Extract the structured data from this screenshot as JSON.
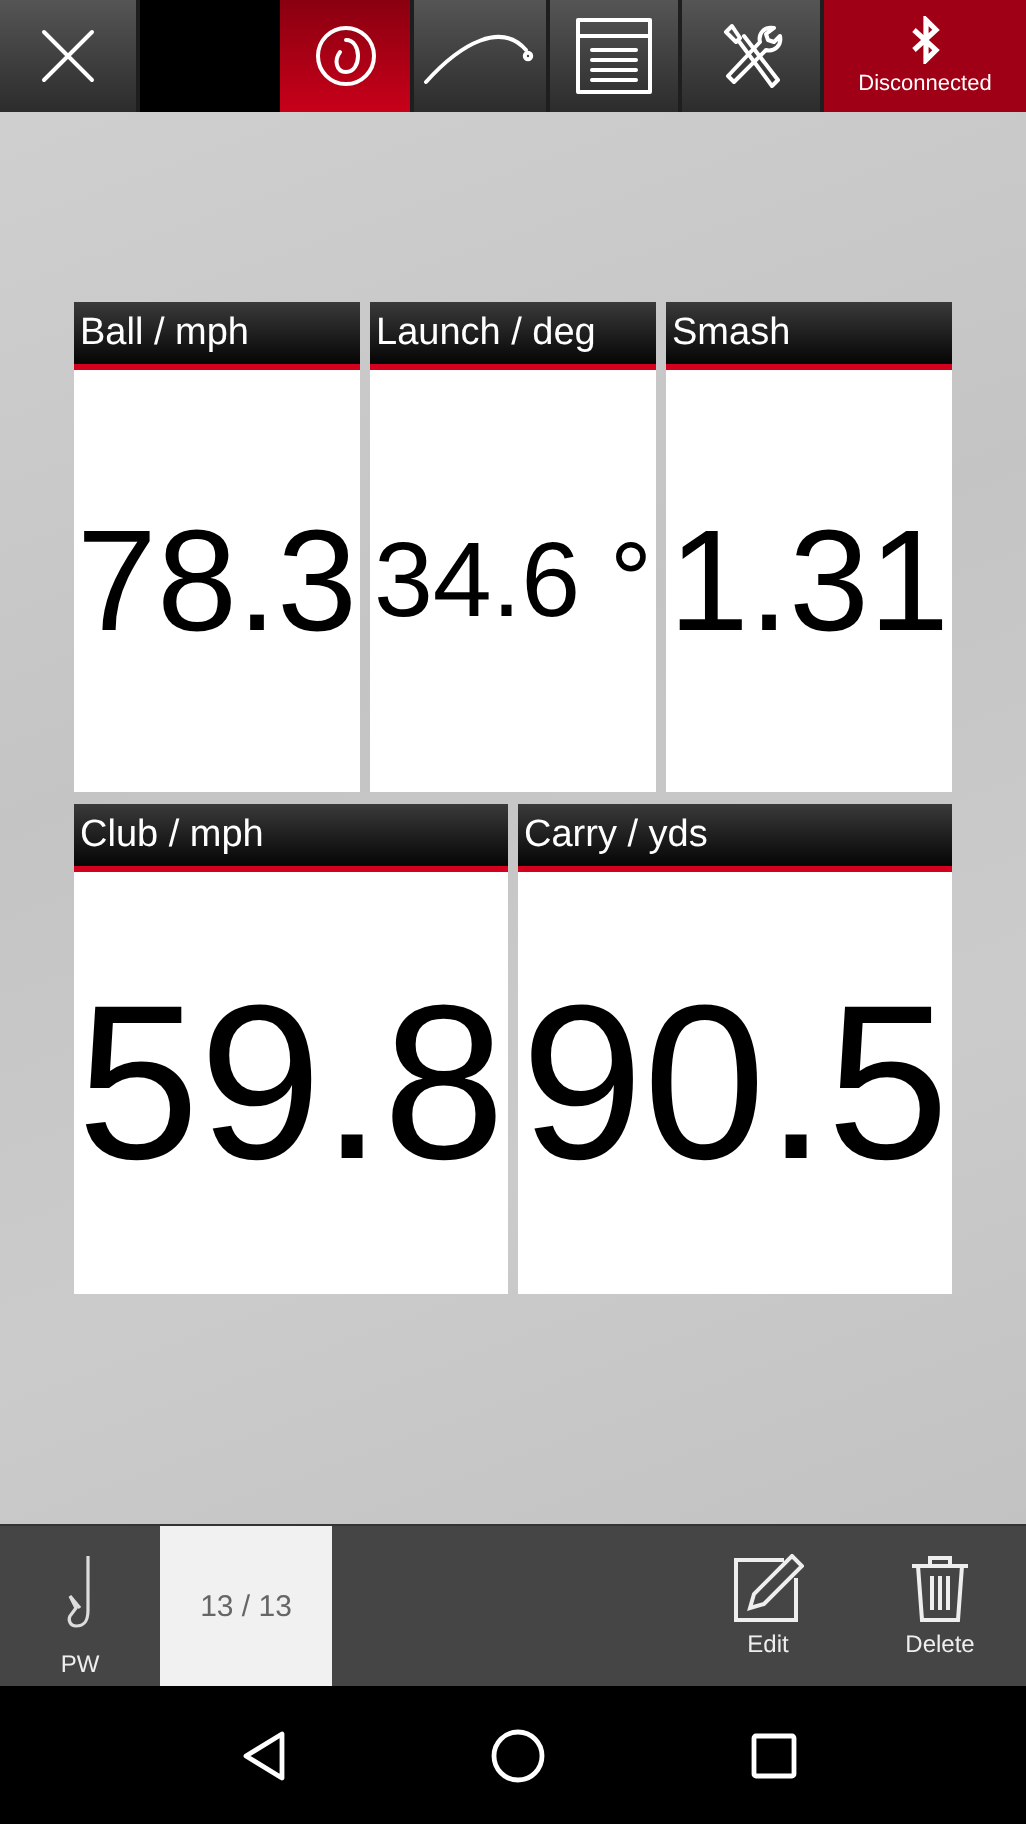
{
  "top_bar": {
    "close_button": {
      "kind": "close"
    },
    "tabs": [
      {
        "kind": "spin",
        "selected": true
      },
      {
        "kind": "trajectory",
        "selected": false
      },
      {
        "kind": "table",
        "selected": false
      },
      {
        "kind": "tools",
        "selected": false
      }
    ],
    "connection": {
      "label": "Disconnected",
      "connected": false
    }
  },
  "metric_rows": [
    {
      "cards": [
        {
          "label": "Ball / mph",
          "value": "78.3"
        },
        {
          "label": "Launch / deg",
          "value": "34.6 °"
        },
        {
          "label": "Smash",
          "value": "1.31"
        }
      ]
    },
    {
      "cards": [
        {
          "label": "Club / mph",
          "value": "59.8"
        },
        {
          "label": "Carry / yds",
          "value": "90.5"
        }
      ]
    }
  ],
  "bottom_bar": {
    "club": {
      "label": "PW"
    },
    "counter": "13 / 13",
    "actions": [
      {
        "kind": "edit",
        "label": "Edit"
      },
      {
        "kind": "delete",
        "label": "Delete"
      }
    ]
  },
  "nav_bar": {
    "buttons": [
      {
        "kind": "back"
      },
      {
        "kind": "home"
      },
      {
        "kind": "recents"
      }
    ]
  }
}
